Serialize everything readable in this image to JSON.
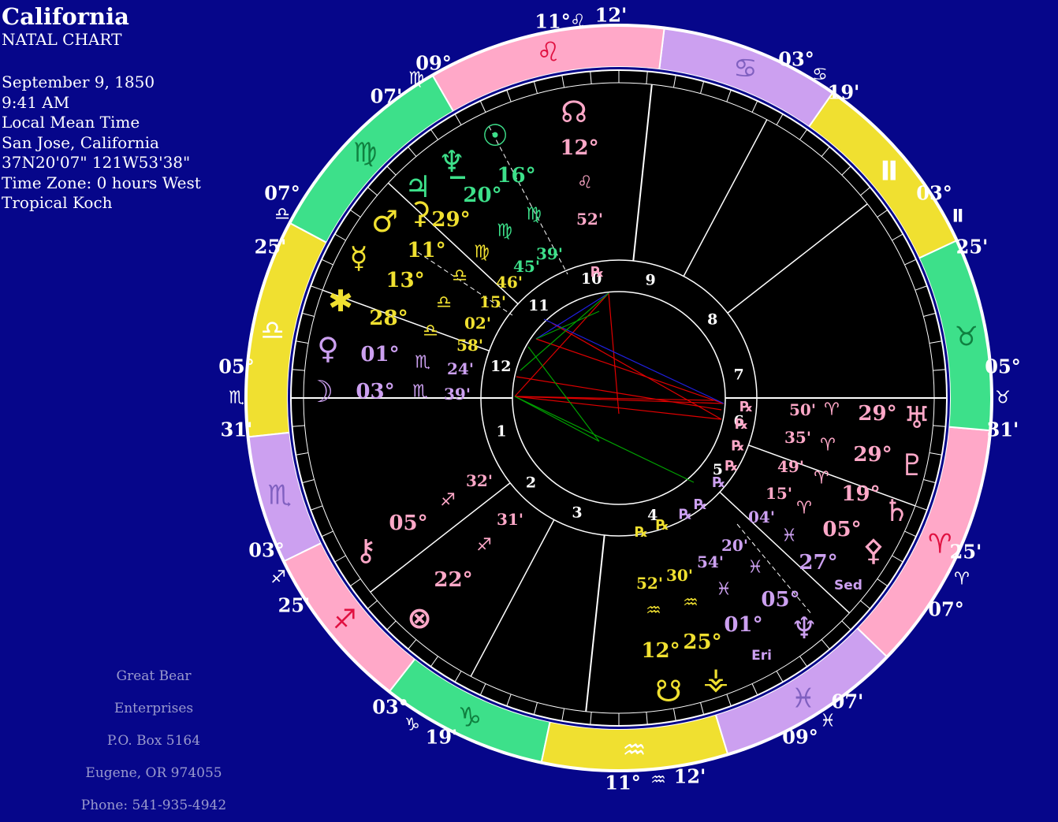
{
  "header": {
    "title": "California",
    "subtitle": "NATAL CHART",
    "lines": [
      "September 9, 1850",
      "9:41 AM",
      "Local Mean Time",
      "San Jose, California",
      "37N20'07\"  121W53'38\"",
      "Time Zone: 0 hours West",
      "Tropical Koch"
    ]
  },
  "company": [
    "Great Bear Enterprises",
    "P.O. Box 5164",
    "Eugene, OR 974055",
    "Phone: 541-935-4942"
  ],
  "colors": {
    "background": "#06068a",
    "fire": "#ffa8c8",
    "earth": "#3de08a",
    "air": "#f0e030",
    "water": "#cca0f0",
    "ring_black": "#000000",
    "aspect_red": "#e00000",
    "aspect_blue": "#2020e0",
    "aspect_green": "#00a000"
  },
  "zodiac_ring": [
    {
      "sign": "Aries",
      "glyph": "♈"
    },
    {
      "sign": "Taurus",
      "glyph": "♉"
    },
    {
      "sign": "Gemini",
      "glyph": "Ⅱ"
    },
    {
      "sign": "Cancer",
      "glyph": "♋"
    },
    {
      "sign": "Leo",
      "glyph": "♌"
    },
    {
      "sign": "Virgo",
      "glyph": "♍"
    },
    {
      "sign": "Libra",
      "glyph": "♎"
    },
    {
      "sign": "Scorpio",
      "glyph": "♏"
    },
    {
      "sign": "Sagittarius",
      "glyph": "♐"
    },
    {
      "sign": "Capricorn",
      "glyph": "♑"
    },
    {
      "sign": "Aquarius",
      "glyph": "♒"
    },
    {
      "sign": "Pisces",
      "glyph": "♓"
    }
  ],
  "house_cusps": [
    {
      "deg": "11°",
      "sign": "♌",
      "min": "12'"
    },
    {
      "deg": "03°",
      "sign": "♋",
      "min": "19'"
    },
    {
      "deg": "03°",
      "sign": "Ⅱ",
      "min": "25'"
    },
    {
      "deg": "05°",
      "sign": "♉",
      "min": "31'"
    },
    {
      "deg": "25'",
      "sign": "♈",
      "min": "07°"
    },
    {
      "deg": "07'",
      "sign": "♓",
      "min": "09°"
    },
    {
      "deg": "11°",
      "sign": "♒",
      "min": "12'"
    },
    {
      "deg": "03°",
      "sign": "♑",
      "min": "19'"
    },
    {
      "deg": "03°",
      "sign": "♐",
      "min": "25'"
    },
    {
      "deg": "05°",
      "sign": "♏",
      "min": "31'"
    },
    {
      "deg": "07°",
      "sign": "♎",
      "min": "25'"
    },
    {
      "deg": "09°",
      "sign": "♍",
      "min": "07'"
    }
  ],
  "house_numbers": [
    "1",
    "2",
    "3",
    "4",
    "5",
    "6",
    "7",
    "8",
    "9",
    "10",
    "11",
    "12"
  ],
  "planets": [
    {
      "name": "Sun",
      "glyph": "☉",
      "deg": "16°",
      "sign": "♍",
      "min": "39'",
      "retro": ""
    },
    {
      "name": "Vertex",
      "glyph": "♆̲",
      "deg": "",
      "sign": "",
      "min": "",
      "retro": ""
    },
    {
      "name": "Jupiter",
      "glyph": "♃",
      "deg": "20°",
      "sign": "♍",
      "min": "45'",
      "retro": ""
    },
    {
      "name": "Mars",
      "glyph": "♂",
      "deg": "29°",
      "sign": "♍",
      "min": "46'",
      "retro": ""
    },
    {
      "name": "Mercury",
      "glyph": "☿",
      "deg": "11°",
      "sign": "♎",
      "min": "15'",
      "retro": ""
    },
    {
      "name": "Juno",
      "glyph": "✱",
      "deg": "13°",
      "sign": "♎",
      "min": "02'",
      "retro": ""
    },
    {
      "name": "Ceres",
      "glyph": "⚳",
      "deg": "28°",
      "sign": "♎",
      "min": "58'",
      "retro": ""
    },
    {
      "name": "Venus",
      "glyph": "♀",
      "deg": "01°",
      "sign": "♏",
      "min": "24'",
      "retro": ""
    },
    {
      "name": "Moon",
      "glyph": "☽",
      "deg": "03°",
      "sign": "♏",
      "min": "39'",
      "retro": ""
    },
    {
      "name": "North Node",
      "glyph": "☊",
      "deg": "12°",
      "sign": "♌",
      "min": "52'",
      "retro": "℞"
    },
    {
      "name": "Uranus",
      "glyph": "♅",
      "deg": "29°",
      "sign": "♈",
      "min": "50'",
      "retro": "℞"
    },
    {
      "name": "Pluto",
      "glyph": "♇",
      "deg": "29°",
      "sign": "♈",
      "min": "35'",
      "retro": "℞"
    },
    {
      "name": "Saturn",
      "glyph": "♄",
      "deg": "19°",
      "sign": "♈",
      "min": "49'",
      "retro": "℞"
    },
    {
      "name": "Chiron",
      "glyph": "⚷",
      "deg": "05°",
      "sign": "♐",
      "min": "32'",
      "retro": ""
    },
    {
      "name": "Part of Fortune",
      "glyph": "⊗",
      "deg": "22°",
      "sign": "♐",
      "min": "31'",
      "retro": ""
    },
    {
      "name": "Pallas",
      "glyph": "⚴",
      "deg": "05°",
      "sign": "♈",
      "min": "15'",
      "retro": "℞"
    },
    {
      "name": "Sedna",
      "glyph": "Sed",
      "deg": "27°",
      "sign": "♓",
      "min": "04'",
      "retro": "℞"
    },
    {
      "name": "Neptune",
      "glyph": "♆",
      "deg": "05°",
      "sign": "♓",
      "min": "20'",
      "retro": "℞"
    },
    {
      "name": "Eris",
      "glyph": "Eri",
      "deg": "01°",
      "sign": "♓",
      "min": "54'",
      "retro": "℞"
    },
    {
      "name": "South Node",
      "glyph": "☋",
      "deg": "12°",
      "sign": "♒",
      "min": "52'",
      "retro": "℞"
    },
    {
      "name": "Vesta",
      "glyph": "⚶",
      "deg": "25°",
      "sign": "♒",
      "min": "30'",
      "retro": "℞"
    }
  ]
}
